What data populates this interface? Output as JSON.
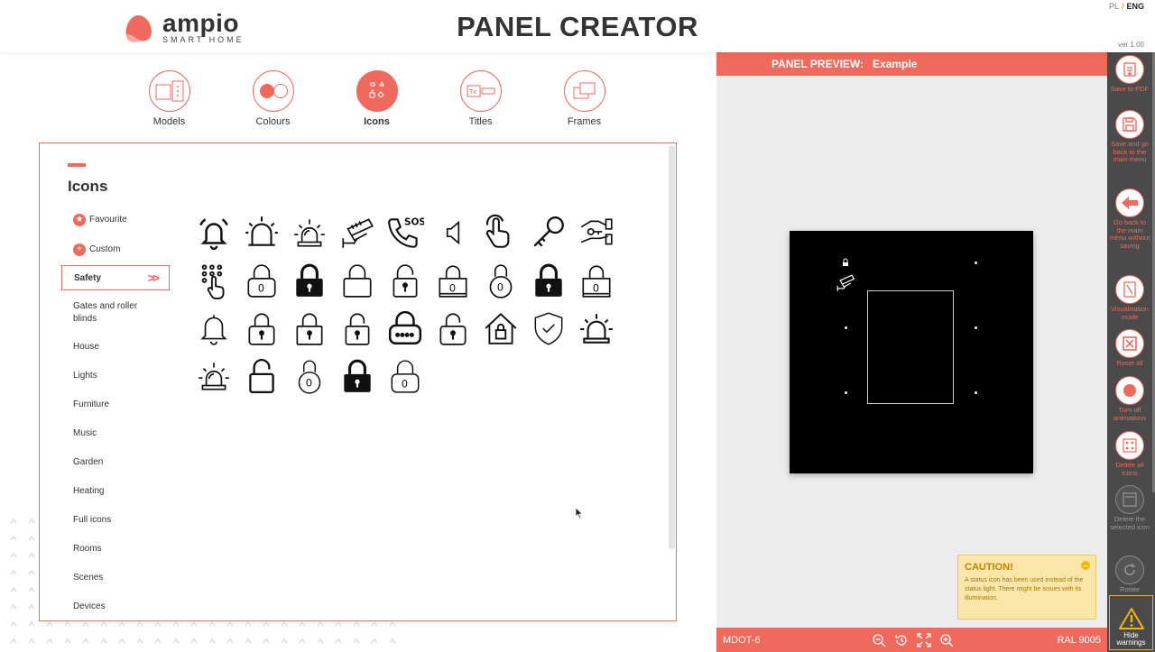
{
  "header": {
    "logo_word": "ampio",
    "logo_sub": "SMART HOME",
    "title": "PANEL CREATOR",
    "lang_pl": "PL",
    "lang_sep": "/",
    "lang_eng": "ENG",
    "version": "ver 1.00"
  },
  "steps": [
    {
      "label": "Models",
      "icon": "models-icon",
      "active": false
    },
    {
      "label": "Colours",
      "icon": "colours-icon",
      "active": false
    },
    {
      "label": "Icons",
      "icon": "icons-icon",
      "active": true
    },
    {
      "label": "Titles",
      "icon": "titles-icon",
      "active": false
    },
    {
      "label": "Frames",
      "icon": "frames-icon",
      "active": false
    }
  ],
  "card": {
    "title": "Icons",
    "categories": [
      {
        "label": "Favourite",
        "icon": "star-icon"
      },
      {
        "label": "Custom",
        "icon": "plus-icon"
      },
      {
        "label": "Safety",
        "active": true
      },
      {
        "label": "Gates and roller blinds"
      },
      {
        "label": "House"
      },
      {
        "label": "Lights"
      },
      {
        "label": "Furniture"
      },
      {
        "label": "Music"
      },
      {
        "label": "Garden"
      },
      {
        "label": "Heating"
      },
      {
        "label": "Full icons"
      },
      {
        "label": "Rooms"
      },
      {
        "label": "Scenes"
      },
      {
        "label": "Devices"
      }
    ],
    "sos_text": "SOS",
    "icon_rows": [
      [
        "bell-ringing-icon",
        "alarm-light-icon",
        "siren-icon",
        "cctv-camera-icon",
        "sos-phone-icon",
        "speaker-icon",
        "hand-pointer-icon",
        "key-icon",
        "hand-key-icon"
      ],
      [
        "keypad-icon",
        "padlock-code-icon",
        "padlock-filled-icon",
        "padlock-open-icon",
        "padlock-open-keyhole-icon",
        "padlock-code-square-icon",
        "padlock-round-code-icon",
        "padlock-filled-keyhole-icon",
        "padlock-code-square-icon-2"
      ],
      [
        "bell-icon",
        "padlock-keyhole-icon",
        "padlock-keyhole-icon-2",
        "padlock-open-keyhole-icon-2",
        "padlock-password-icon",
        "padlock-open-keyhole-icon-3",
        "house-lock-icon",
        "shield-check-icon",
        "siren-light-icon"
      ],
      [
        "siren-rays-icon",
        "padlock-open-big-icon",
        "padlock-round-code-icon-2",
        "padlock-filled-keyhole-icon-2",
        "padlock-code-icon-2"
      ]
    ]
  },
  "preview": {
    "label": "PANEL PREVIEW:",
    "name": "Example",
    "caution_title": "CAUTION!",
    "caution_text": "A status icon has been used instead of the status light. There might be issues with its illumination.",
    "caution_min": "–",
    "model": "MDOT-6",
    "ral": "RAL 9005"
  },
  "toolbar": [
    {
      "label": "Save to PDF",
      "icon": "pdf-icon"
    },
    {
      "label": "Save and go back to the main menu",
      "icon": "floppy-disk-icon"
    },
    {
      "label": "Go back to the main menu without saving",
      "icon": "arrow-left-icon"
    },
    {
      "label": "Visualisation mode",
      "icon": "visualisation-icon"
    },
    {
      "label": "Reset all",
      "icon": "reset-x-icon"
    },
    {
      "label": "Turn off animations",
      "icon": "record-icon"
    },
    {
      "label": "Delete all icons",
      "icon": "delete-all-icon"
    },
    {
      "label": "Delete the selected icon",
      "icon": "delete-selected-icon"
    },
    {
      "label": "Rotate",
      "icon": "rotate-icon"
    }
  ],
  "warnings_btn": "Hide warnings",
  "colors": {
    "accent": "#ef6a5c",
    "toolbar": "#4a4a4a",
    "warning": "#f2b705",
    "panel": "#000000"
  }
}
